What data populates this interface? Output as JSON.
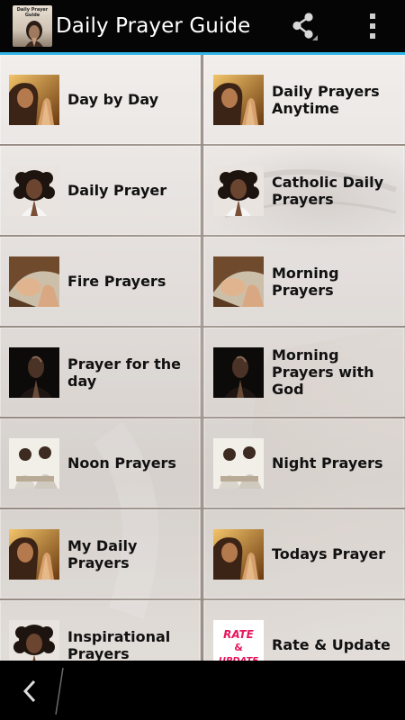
{
  "app": {
    "title": "Daily Prayer Guide",
    "icon_caption": "Daily Prayer Guide",
    "accent_color": "#33b5e5"
  },
  "actions": {
    "share_icon": "share-icon",
    "overflow_icon": "overflow-menu-icon"
  },
  "tiles": [
    {
      "label": "Day by Day",
      "thumb": "praying-hands-woman"
    },
    {
      "label": "Daily Prayers Anytime",
      "thumb": "praying-hands-woman"
    },
    {
      "label": "Daily Prayer",
      "thumb": "woman-curly-hair-praying"
    },
    {
      "label": "Catholic Daily Prayers",
      "thumb": "woman-curly-hair-praying"
    },
    {
      "label": "Fire Prayers",
      "thumb": "woman-head-bowed"
    },
    {
      "label": "Morning Prayers",
      "thumb": "woman-head-bowed"
    },
    {
      "label": "Prayer for the day",
      "thumb": "person-looking-up-dark"
    },
    {
      "label": "Morning Prayers with God",
      "thumb": "person-looking-up-dark"
    },
    {
      "label": "Noon Prayers",
      "thumb": "couple-praying"
    },
    {
      "label": "Night Prayers",
      "thumb": "couple-praying"
    },
    {
      "label": "My Daily Prayers",
      "thumb": "praying-hands-woman"
    },
    {
      "label": "Todays Prayer",
      "thumb": "praying-hands-woman"
    },
    {
      "label": "Inspirational Prayers",
      "thumb": "woman-curly-hair-praying"
    },
    {
      "label": "Rate & Update",
      "thumb": "rate-update-badge",
      "thumb_text": [
        "RATE",
        "&",
        "UPDATE"
      ]
    }
  ],
  "nav": {
    "back_icon": "back-icon"
  }
}
